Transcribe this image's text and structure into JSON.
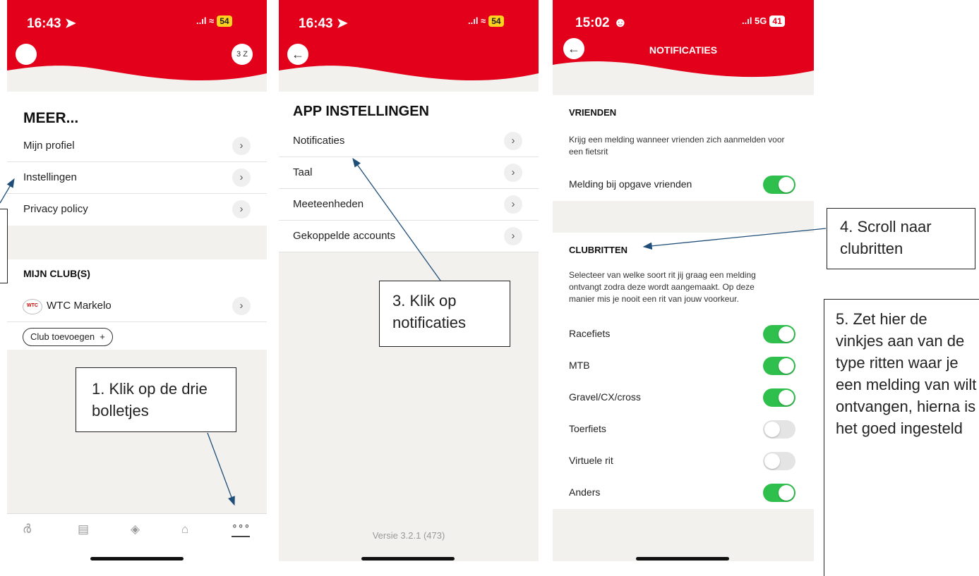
{
  "colors": {
    "brand_red": "#e3001b",
    "toggle_on": "#2fbf4c",
    "toggle_off": "#e4e4e4",
    "bg_grey": "#f2f1ee"
  },
  "screen1": {
    "time": "16:43 ➤",
    "status": "..ıl ≈",
    "battery": "54",
    "location_icon_text": "3 Z",
    "heading": "MEER...",
    "menu": [
      "Mijn profiel",
      "Instellingen",
      "Privacy policy"
    ],
    "club_heading": "MIJN CLUB(S)",
    "club_name": "WTC Markelo",
    "club_logo_text": "WTC",
    "add_club": "Club toevoegen  +",
    "tab_icons": [
      "bike-icon",
      "news-icon",
      "compass-icon",
      "tag-icon",
      "more-icon"
    ],
    "tab_glyphs": [
      "ർ",
      "▤",
      "◈",
      "⌂",
      "∘∘∘"
    ]
  },
  "screen2": {
    "time": "16:43 ➤",
    "status": "..ıl ≈",
    "battery": "54",
    "heading": "APP INSTELLINGEN",
    "menu": [
      "Notificaties",
      "Taal",
      "Meeteenheden",
      "Gekoppelde accounts"
    ],
    "version": "Versie 3.2.1 (473)"
  },
  "screen3": {
    "time": "15:02 ☻",
    "status": "..ıl 5G",
    "battery": "41",
    "title": "NOTIFICATIES",
    "friends_heading": "VRIENDEN",
    "friends_desc": "Krijg een melding wanneer vrienden zich aanmelden voor een fietsrit",
    "friends_toggle_label": "Melding bij opgave vrienden",
    "friends_toggle_on": true,
    "clubrides_heading": "CLUBRITTEN",
    "clubrides_desc": "Selecteer van welke soort rit jij graag een melding ontvangt zodra deze wordt aangemaakt. Op deze manier mis je nooit een rit van jouw voorkeur.",
    "ride_types": [
      {
        "label": "Racefiets",
        "on": true
      },
      {
        "label": "MTB",
        "on": true
      },
      {
        "label": "Gravel/CX/cross",
        "on": true
      },
      {
        "label": "Toerfiets",
        "on": false
      },
      {
        "label": "Virtuele rit",
        "on": false
      },
      {
        "label": "Anders",
        "on": true
      }
    ]
  },
  "callouts": {
    "step1": "1. Klik op de drie bolletjes",
    "step3": "3. Klik op notificaties",
    "step4": "4. Scroll naar clubritten",
    "step5": "5. Zet hier de vinkjes aan van de type ritten waar je een melding van wilt ontvangen, hierna is het goed ingesteld"
  }
}
